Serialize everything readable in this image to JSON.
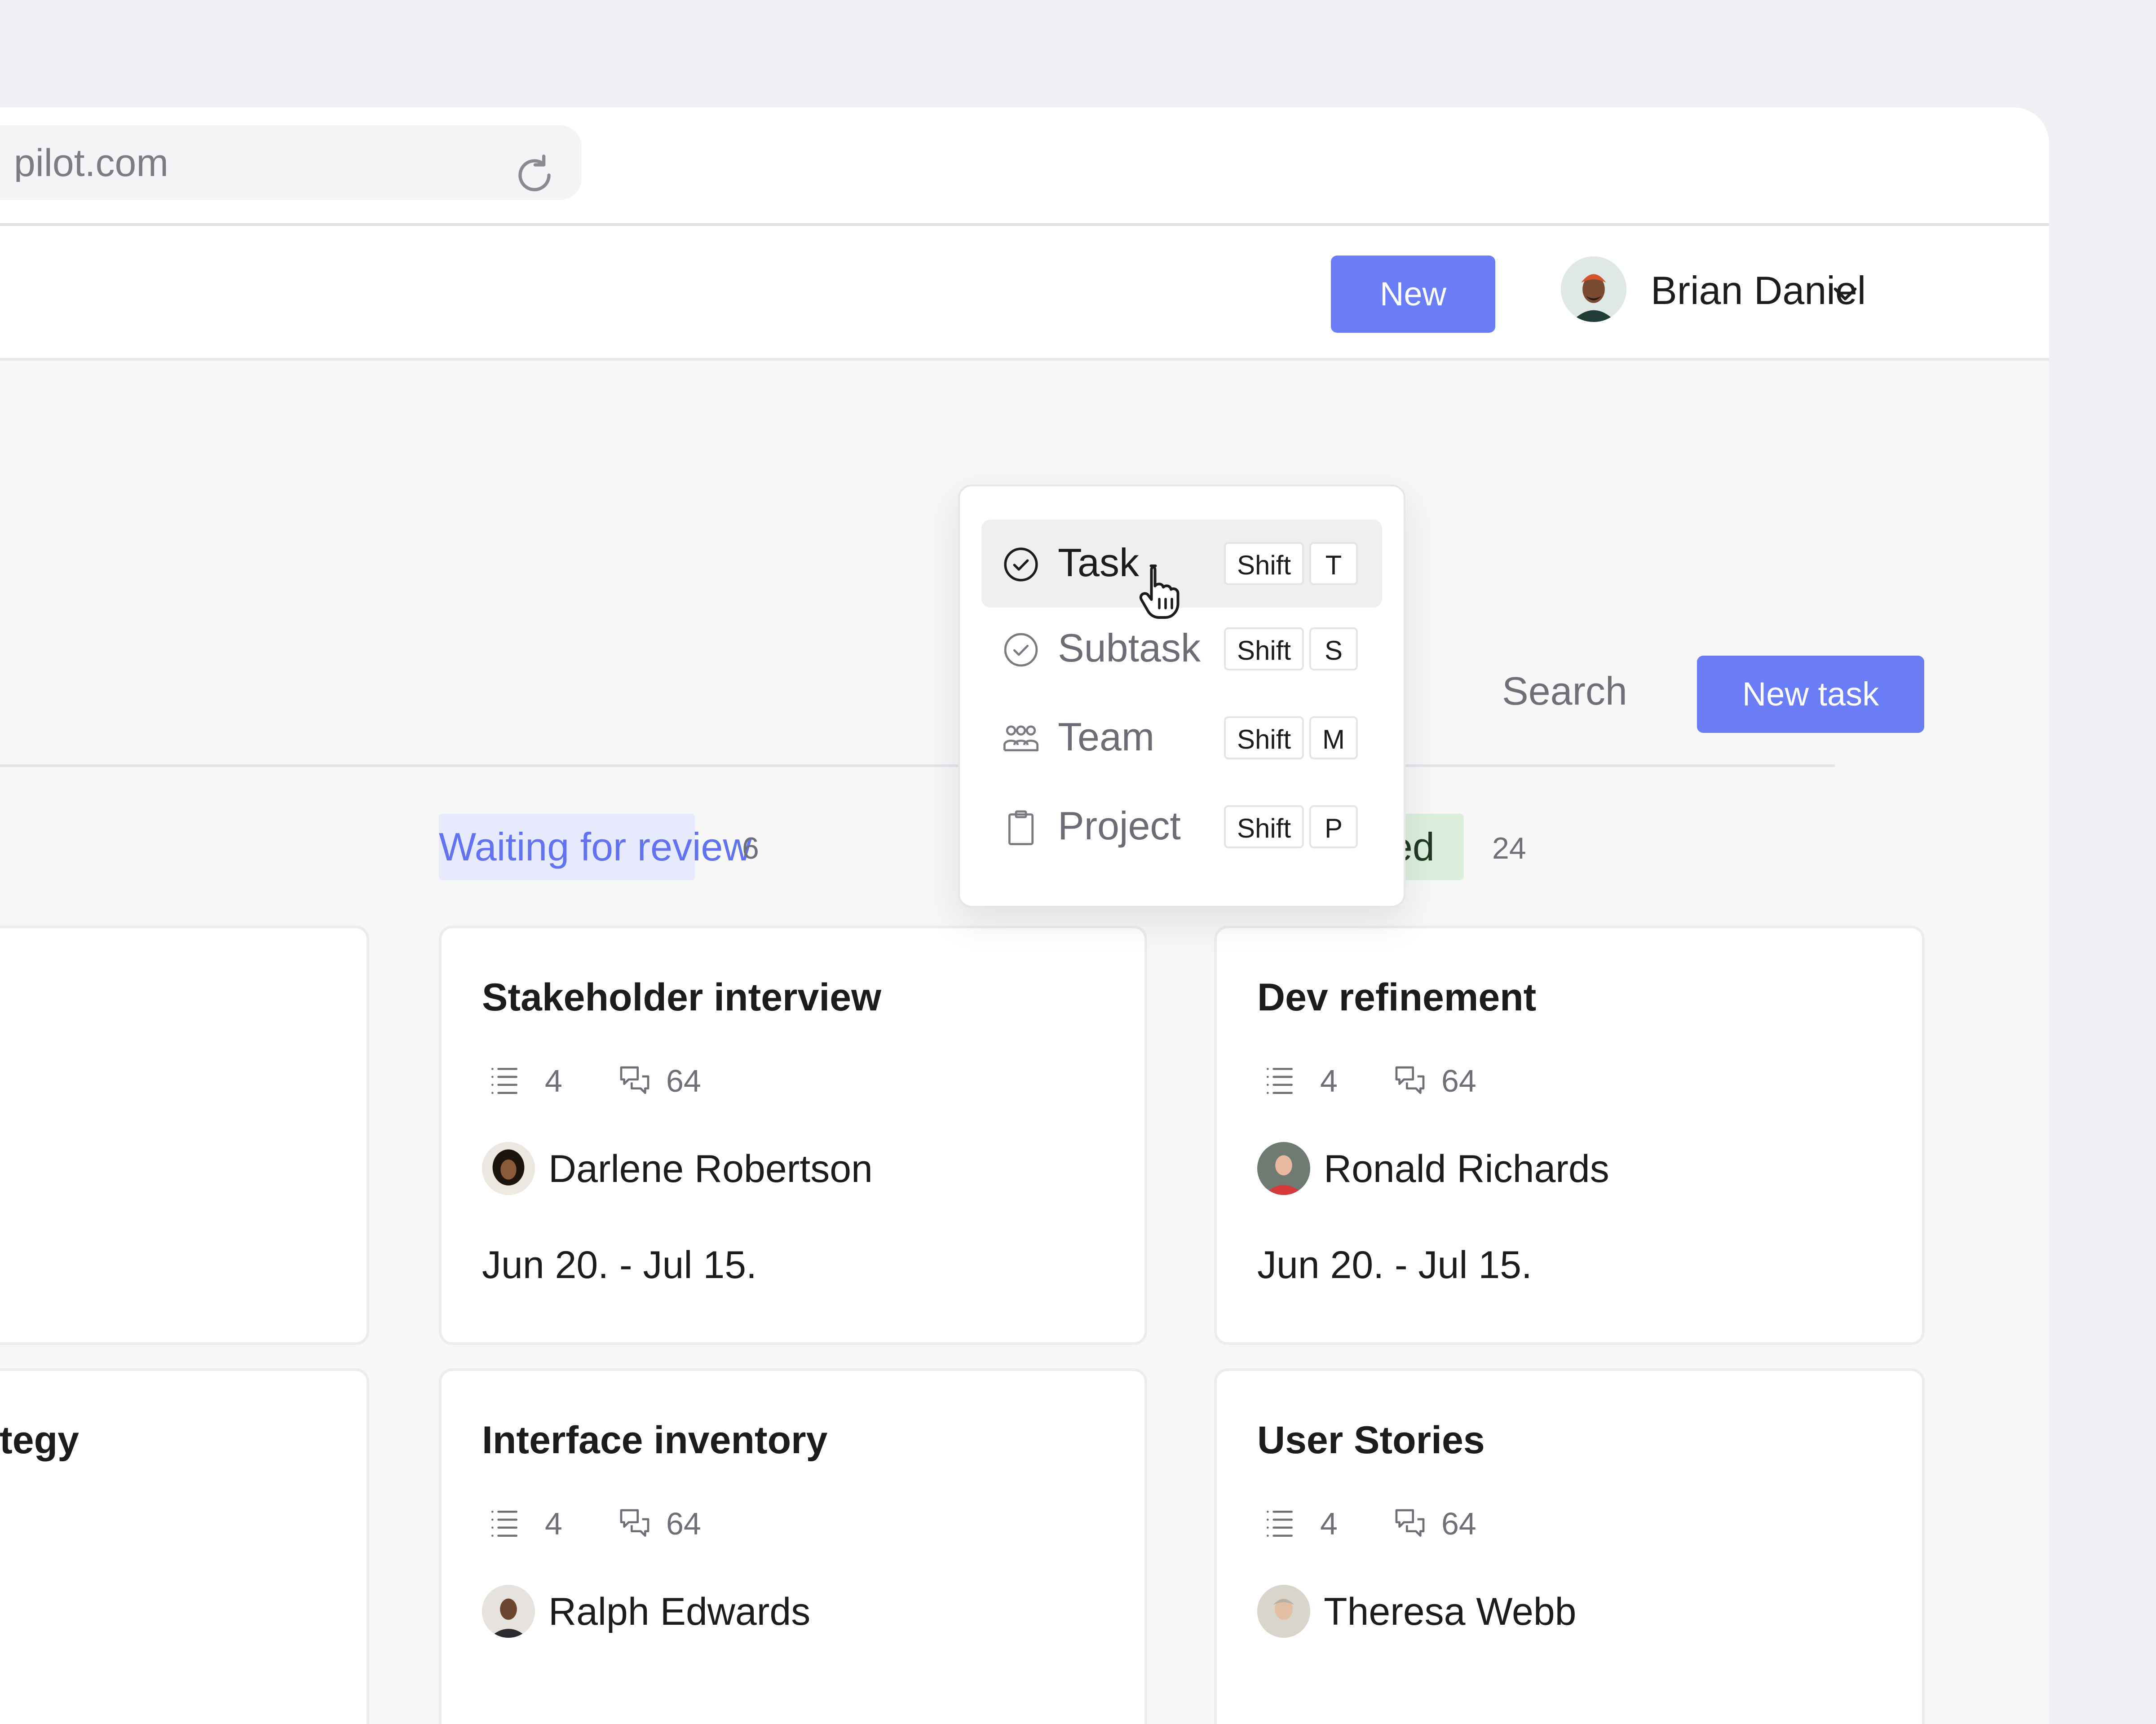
{
  "browser": {
    "url": "pilot.com"
  },
  "header": {
    "new_button": "New",
    "user": {
      "name": "Brian Daniel"
    }
  },
  "toolbar": {
    "search_label": "Search",
    "new_task_button": "New task"
  },
  "new_menu": {
    "items": [
      {
        "label": "Task",
        "icon": "task-check-icon",
        "shortcut_modifier": "Shift",
        "shortcut_key": "T",
        "active": true
      },
      {
        "label": "Subtask",
        "icon": "subtask-check-icon",
        "shortcut_modifier": "Shift",
        "shortcut_key": "S"
      },
      {
        "label": "Team",
        "icon": "team-icon",
        "shortcut_modifier": "Shift",
        "shortcut_key": "M"
      },
      {
        "label": "Project",
        "icon": "clipboard-icon",
        "shortcut_modifier": "Shift",
        "shortcut_key": "P"
      }
    ]
  },
  "columns": {
    "review": {
      "label": "Waiting for review",
      "count": "6",
      "cards": [
        {
          "title": "Stakeholder interview",
          "subtasks": "4",
          "comments": "64",
          "assignee": "Darlene Robertson",
          "date": "Jun 20. - Jul 15."
        },
        {
          "title": "Interface inventory",
          "subtasks": "4",
          "comments": "64",
          "assignee": "Ralph Edwards"
        }
      ]
    },
    "completed": {
      "label": "Completed",
      "count": "24",
      "cards": [
        {
          "title": "Dev refinement",
          "subtasks": "4",
          "comments": "64",
          "assignee": "Ronald Richards",
          "date": "Jun 20. - Jul 15."
        },
        {
          "title": "User Stories",
          "subtasks": "4",
          "comments": "64",
          "assignee": "Theresa Webb"
        }
      ]
    },
    "left_partial": {
      "card_title_fragment": "tegy"
    }
  },
  "colors": {
    "accent": "#6B7CF7",
    "review_tag_bg": "#E7E9FD",
    "done_tag_bg": "#DCEFDC"
  }
}
